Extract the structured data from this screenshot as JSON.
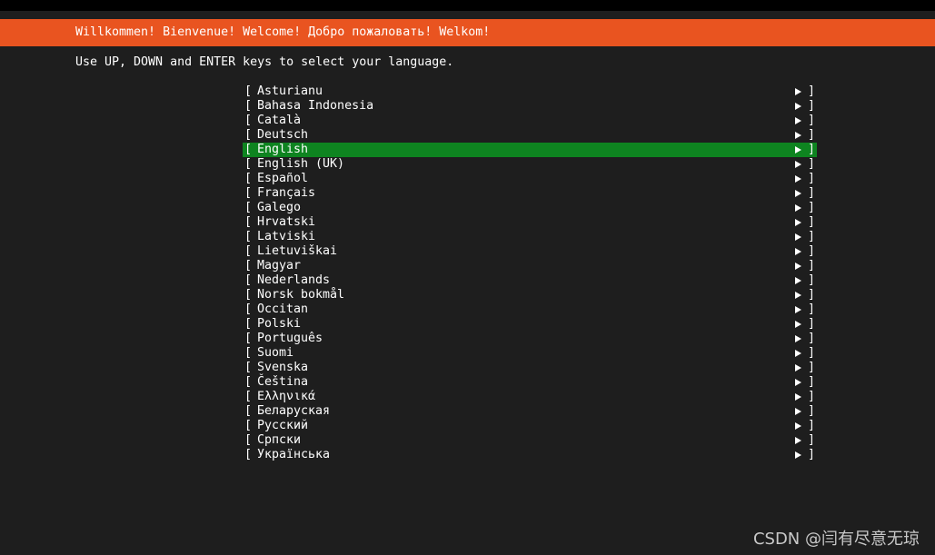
{
  "header": {
    "welcome_text": "Willkommen! Bienvenue! Welcome! Добро пожаловать! Welkom!"
  },
  "instruction": "Use UP, DOWN and ENTER keys to select your language.",
  "languages": [
    {
      "label": "Asturianu"
    },
    {
      "label": "Bahasa Indonesia"
    },
    {
      "label": "Català"
    },
    {
      "label": "Deutsch"
    },
    {
      "label": "English",
      "selected": true
    },
    {
      "label": "English (UK)"
    },
    {
      "label": "Español"
    },
    {
      "label": "Français"
    },
    {
      "label": "Galego"
    },
    {
      "label": "Hrvatski"
    },
    {
      "label": "Latviski"
    },
    {
      "label": "Lietuviškai"
    },
    {
      "label": "Magyar"
    },
    {
      "label": "Nederlands"
    },
    {
      "label": "Norsk bokmål"
    },
    {
      "label": "Occitan"
    },
    {
      "label": "Polski"
    },
    {
      "label": "Português"
    },
    {
      "label": "Suomi"
    },
    {
      "label": "Svenska"
    },
    {
      "label": "Čeština"
    },
    {
      "label": "Ελληνικά"
    },
    {
      "label": "Беларуская"
    },
    {
      "label": "Русский"
    },
    {
      "label": "Српски"
    },
    {
      "label": "Українська"
    }
  ],
  "list_decor": {
    "open_bracket": "[",
    "close_bracket": "]"
  },
  "watermark": "CSDN @闫有尽意无琼",
  "colors": {
    "header_bg": "#e95420",
    "selected_bg": "#0e8420",
    "screen_bg": "#1e1e1e"
  },
  "icons": {
    "item_arrow": "right-triangle-icon"
  }
}
